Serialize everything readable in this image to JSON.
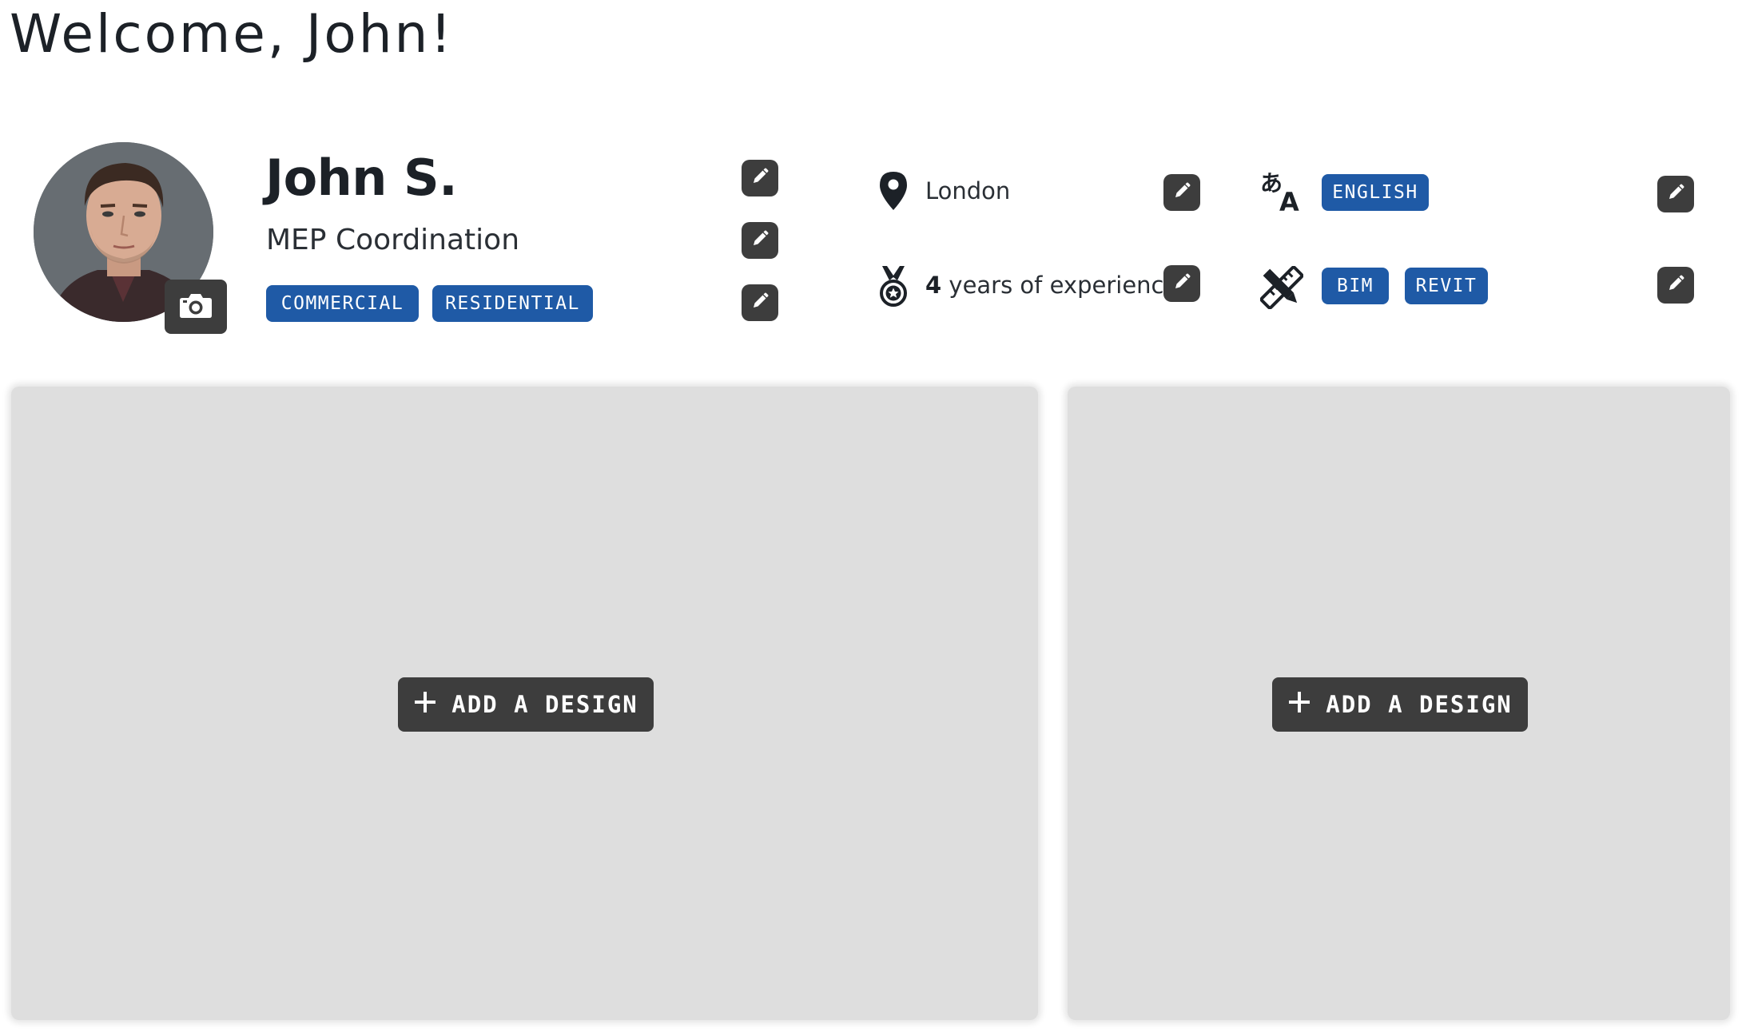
{
  "header": {
    "welcome": "Welcome, John!"
  },
  "profile": {
    "name": "John S.",
    "specialty": "MEP Coordination",
    "sectors": [
      "COMMERCIAL",
      "RESIDENTIAL"
    ],
    "location": "London",
    "experience_years": "4",
    "experience_suffix": " years of experience",
    "languages": [
      "ENGLISH"
    ],
    "software": [
      "BIM",
      "REVIT"
    ]
  },
  "designs": {
    "add_label": "ADD A DESIGN"
  },
  "icons": {
    "camera": "camera-icon",
    "edit": "pencil-icon",
    "location": "map-pin-icon",
    "experience": "medal-icon",
    "language": "translate-icon",
    "software": "design-tools-icon",
    "add": "plus-icon"
  },
  "colors": {
    "tag_blue": "#1f5aa6",
    "button_dark": "#3d3d3d",
    "card_gray": "#dedede",
    "text_dark": "#1c2127"
  }
}
